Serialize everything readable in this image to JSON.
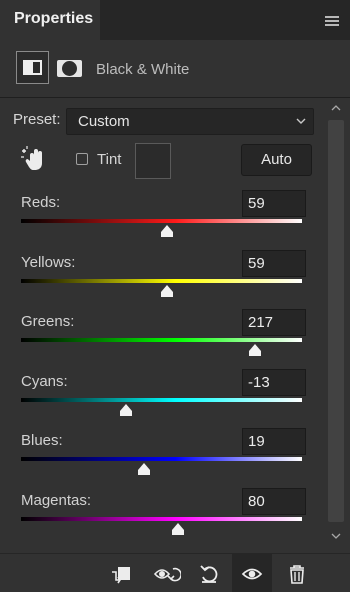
{
  "panel": {
    "title": "Properties",
    "adjustment_name": "Black & White"
  },
  "preset": {
    "label": "Preset:",
    "value": "Custom"
  },
  "tint": {
    "label": "Tint",
    "checked": false,
    "color": "#2b2b2b"
  },
  "auto_button": {
    "label": "Auto"
  },
  "sliders": [
    {
      "label": "Reds:",
      "value": "59",
      "min": -200,
      "max": 300,
      "gradient": [
        "#000000",
        "#ff1a1a",
        "#ffffff"
      ]
    },
    {
      "label": "Yellows:",
      "value": "59",
      "min": -200,
      "max": 300,
      "gradient": [
        "#000000",
        "#ffff00",
        "#ffffff"
      ]
    },
    {
      "label": "Greens:",
      "value": "217",
      "min": -200,
      "max": 300,
      "gradient": [
        "#000000",
        "#00ff00",
        "#ffffff"
      ]
    },
    {
      "label": "Cyans:",
      "value": "-13",
      "min": -200,
      "max": 300,
      "gradient": [
        "#000000",
        "#00ffff",
        "#ffffff"
      ]
    },
    {
      "label": "Blues:",
      "value": "19",
      "min": -200,
      "max": 300,
      "gradient": [
        "#000000",
        "#0000ff",
        "#ffffff"
      ]
    },
    {
      "label": "Magentas:",
      "value": "80",
      "min": -200,
      "max": 300,
      "gradient": [
        "#000000",
        "#ff00ff",
        "#ffffff"
      ]
    }
  ],
  "footer": {
    "icons": [
      "clip-to-layer-icon",
      "view-previous-state-icon",
      "reset-icon",
      "toggle-visibility-icon",
      "delete-icon"
    ]
  }
}
